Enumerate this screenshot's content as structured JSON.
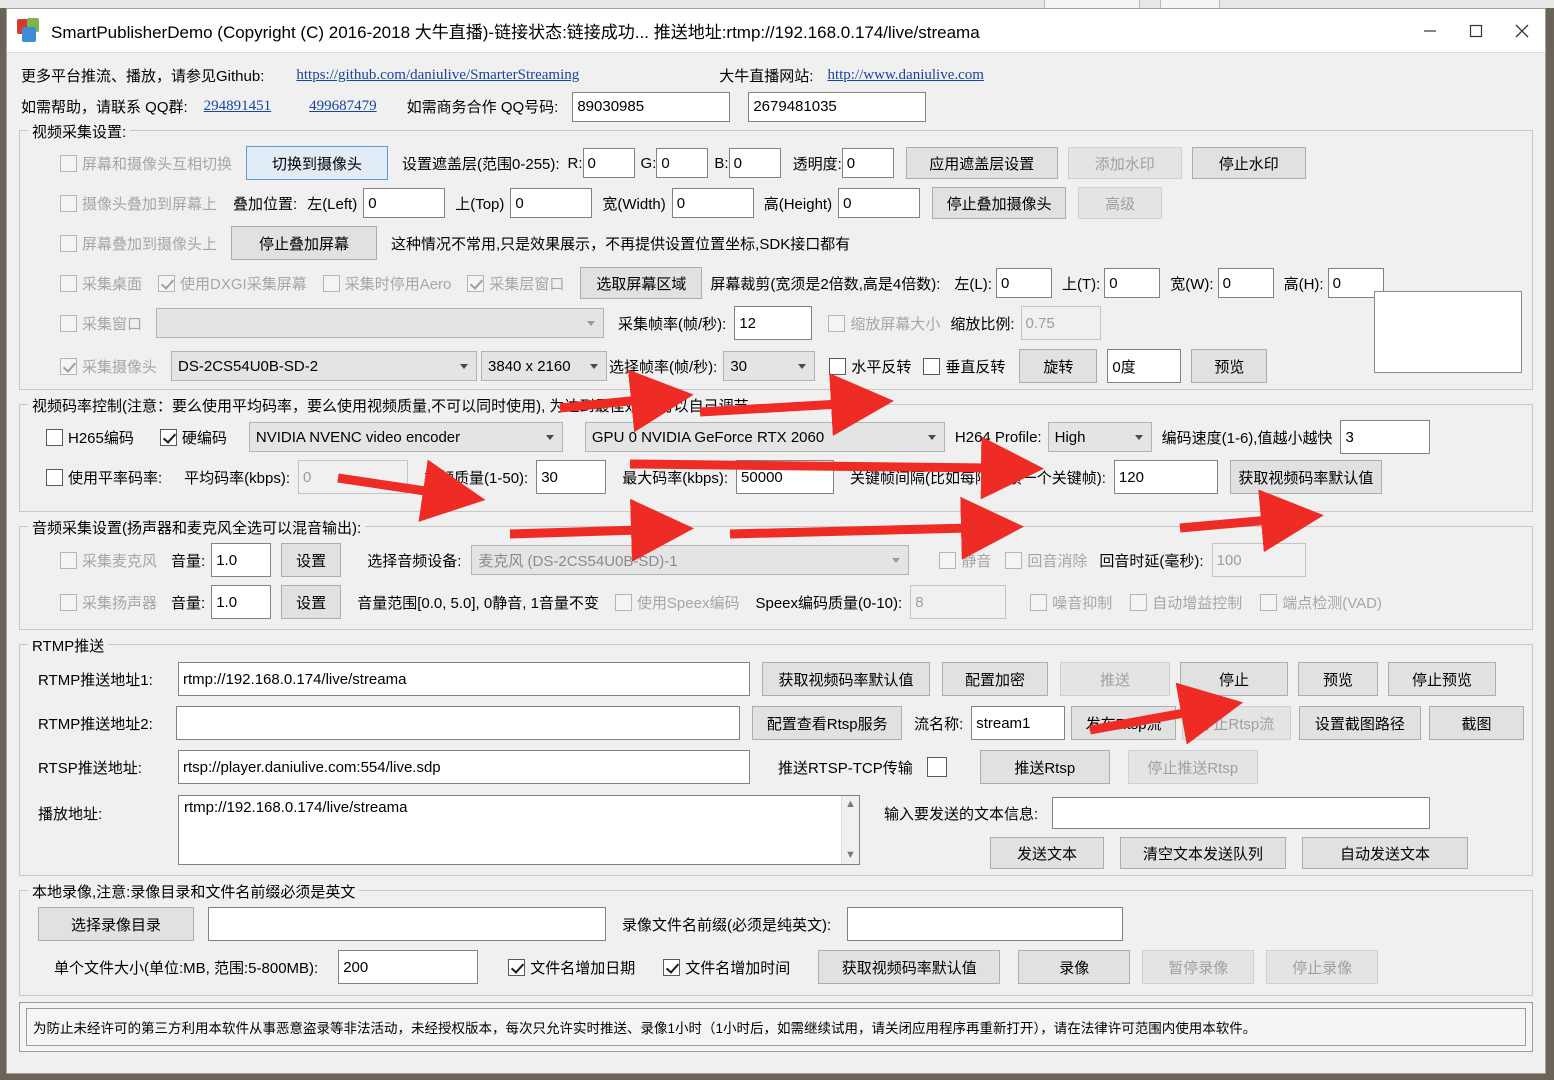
{
  "window": {
    "title": "SmartPublisherDemo  (Copyright (C) 2016-2018 大牛直播)-链接状态:链接成功... 推送地址:rtmp://192.168.0.174/live/streama",
    "minimize": "—",
    "maximize": "□",
    "close": "✕"
  },
  "header": {
    "github_label": "更多平台推流、播放，请参见Github:",
    "github_link": "https://github.com/daniulive/SmarterStreaming",
    "site_label": "大牛直播网站:",
    "site_link": "http://www.daniulive.com",
    "qq_help_label": "如需帮助，请联系 QQ群:",
    "qq_group_1": "294891451",
    "qq_group_2": "499687479",
    "business_label": "如需商务合作 QQ号码:",
    "business_qq_1": "89030985",
    "business_qq_2": "2679481035"
  },
  "video_capture": {
    "legend": "视频采集设置:",
    "swap_screen_camera": "屏幕和摄像头互相切换",
    "switch_to_camera_btn": "切换到摄像头",
    "mask_label": "设置遮盖层(范围0-255):",
    "r_label": "R:",
    "r_value": "0",
    "g_label": "G:",
    "g_value": "0",
    "b_label": "B:",
    "b_value": "0",
    "alpha_label": "透明度:",
    "alpha_value": "0",
    "apply_mask_btn": "应用遮盖层设置",
    "add_watermark_btn": "添加水印",
    "stop_watermark_btn": "停止水印",
    "camera_over_screen": "摄像头叠加到屏幕上",
    "overlay_pos_label": "叠加位置:",
    "left_label": "左(Left)",
    "left_value": "0",
    "top_label": "上(Top)",
    "top_value": "0",
    "width_label": "宽(Width)",
    "width_value": "0",
    "height_label": "高(Height)",
    "height_value": "0",
    "stop_camera_overlay_btn": "停止叠加摄像头",
    "advanced_btn": "高级",
    "screen_over_camera": "屏幕叠加到摄像头上",
    "stop_screen_overlay_btn": "停止叠加屏幕",
    "overlay_note": "这种情况不常用,只是效果展示，不再提供设置位置坐标,SDK接口都有",
    "capture_desktop": "采集桌面",
    "use_dxgi": "使用DXGI采集屏幕",
    "disable_aero": "采集时停用Aero",
    "capture_layer_window": "采集层窗口",
    "select_screen_area_btn": "选取屏幕区域",
    "screen_crop_label": "屏幕裁剪(宽须是2倍数,高是4倍数):",
    "crop_l_label": "左(L):",
    "crop_l_value": "0",
    "crop_t_label": "上(T):",
    "crop_t_value": "0",
    "crop_w_label": "宽(W):",
    "crop_w_value": "0",
    "crop_h_label": "高(H):",
    "crop_h_value": "0",
    "capture_window": "采集窗口",
    "window_select_value": "",
    "capture_fps_label": "采集帧率(帧/秒):",
    "capture_fps_value": "12",
    "scale_screen": "缩放屏幕大小",
    "scale_ratio_label": "缩放比例:",
    "scale_ratio_value": "0.75",
    "capture_camera": "采集摄像头",
    "camera_device": "DS-2CS54U0B-SD-2",
    "camera_resolution": "3840 x 2160",
    "select_fps_label": "选择帧率(帧/秒):",
    "select_fps_value": "30",
    "flip_horizontal": "水平反转",
    "flip_vertical": "垂直反转",
    "rotate_btn": "旋转",
    "rotate_value": "0度",
    "preview_btn": "预览"
  },
  "bitrate": {
    "legend": "视频码率控制(注意：要么使用平均码率，要么使用视频质量,不可以同时使用), 为达到最佳效果,可以自己调节",
    "h265": "H265编码",
    "hw_encode": "硬编码",
    "encoder": "NVIDIA NVENC video encoder",
    "gpu": "GPU 0 NVIDIA GeForce RTX 2060",
    "profile_label": "H264 Profile:",
    "profile_value": "High",
    "speed_label": "编码速度(1-6),值越小越快",
    "speed_value": "3",
    "use_avg_bitrate": "使用平率码率:",
    "avg_bitrate_label": "平均码率(kbps):",
    "avg_bitrate_value": "0",
    "quality_label": "视频质量(1-50):",
    "quality_value": "30",
    "max_bitrate_label": "最大码率(kbps):",
    "max_bitrate_value": "50000",
    "keyframe_label": "关键帧间隔(比如每隔10帧一个关键帧):",
    "keyframe_value": "120",
    "get_defaults_btn": "获取视频码率默认值"
  },
  "audio": {
    "legend": "音频采集设置(扬声器和麦克风全选可以混音输出):",
    "capture_mic": "采集麦克风",
    "volume_label": "音量:",
    "mic_volume": "1.0",
    "mic_settings_btn": "设置",
    "device_label": "选择音频设备:",
    "device_value": "麦克风 (DS-2CS54U0B-SD)-1",
    "mute": "静音",
    "echo_cancel": "回音消除",
    "echo_delay_label": "回音时延(毫秒):",
    "echo_delay_value": "100",
    "capture_speaker": "采集扬声器",
    "speaker_volume": "1.0",
    "speaker_settings_btn": "设置",
    "volume_range_note": "音量范围[0.0, 5.0], 0静音, 1音量不变",
    "use_speex": "使用Speex编码",
    "speex_quality_label": "Speex编码质量(0-10):",
    "speex_quality_value": "8",
    "noise_suppress": "噪音抑制",
    "agc": "自动增益控制",
    "vad": "端点检测(VAD)"
  },
  "rtmp": {
    "legend": "RTMP推送",
    "url1_label": "RTMP推送地址1:",
    "url1_value": "rtmp://192.168.0.174/live/streama",
    "url2_label": "RTMP推送地址2:",
    "url2_value": "",
    "rtsp_label": "RTSP推送地址:",
    "rtsp_value": "rtsp://player.daniulive.com:554/live.sdp",
    "get_defaults_btn": "获取视频码率默认值",
    "config_encrypt_btn": "配置加密",
    "push_btn": "推送",
    "stop_btn": "停止",
    "preview_btn": "预览",
    "stop_preview_btn": "停止预览",
    "config_rtsp_btn": "配置查看Rtsp服务",
    "stream_name_label": "流名称:",
    "stream_name_value": "stream1",
    "publish_rtsp_btn": "发布Rtsp流",
    "stop_rtsp_btn": "停止Rtsp流",
    "set_snapshot_path_btn": "设置截图路径",
    "snapshot_btn": "截图",
    "rtsp_tcp_label": "推送RTSP-TCP传输",
    "push_rtsp_btn": "推送Rtsp",
    "stop_push_rtsp_btn": "停止推送Rtsp",
    "play_url_label": "播放地址:",
    "play_url_value": "rtmp://192.168.0.174/live/streama",
    "text_input_label": "输入要发送的文本信息:",
    "text_input_value": "",
    "send_text_btn": "发送文本",
    "clear_text_queue_btn": "清空文本发送队列",
    "auto_send_text_btn": "自动发送文本"
  },
  "record": {
    "legend": "本地录像,注意:录像目录和文件名前缀必须是英文",
    "select_dir_btn": "选择录像目录",
    "dir_value": "",
    "prefix_label": "录像文件名前缀(必须是纯英文):",
    "prefix_value": "",
    "filesize_label": "单个文件大小(单位:MB, 范围:5-800MB):",
    "filesize_value": "200",
    "add_date": "文件名增加日期",
    "add_time": "文件名增加时间",
    "get_defaults_btn": "获取视频码率默认值",
    "record_btn": "录像",
    "pause_btn": "暂停录像",
    "stop_btn": "停止录像"
  },
  "status": {
    "text": "为防止未经许可的第三方利用本软件从事恶意盗录等非法活动，未经授权版本，每次只允许实时推送、录像1小时（1小时后，如需继续试用，请关闭应用程序再重新打开），请在法律许可范围内使用本软件。"
  },
  "colors": {
    "arrow": "#ee2b24",
    "link": "#1746a0",
    "window_bg": "#f0f0f0"
  }
}
